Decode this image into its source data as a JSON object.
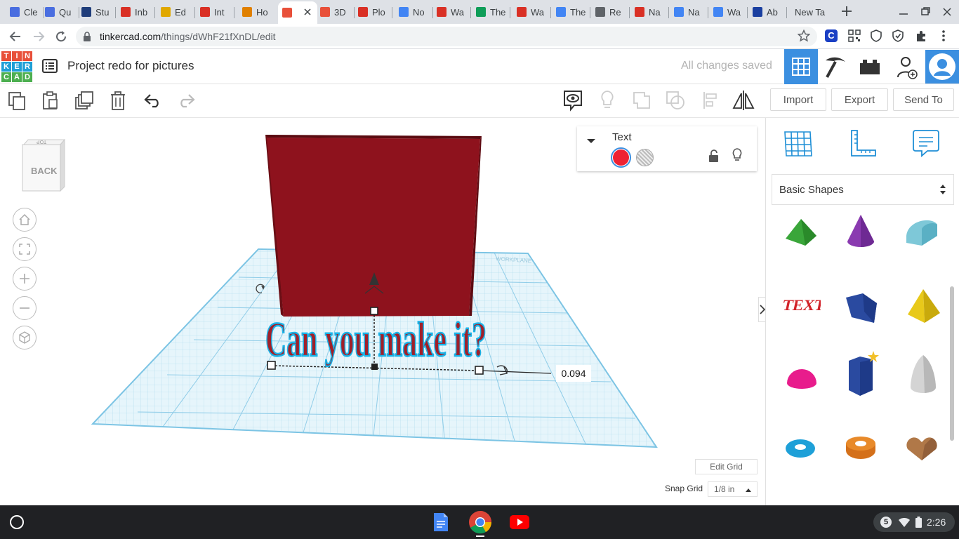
{
  "browser": {
    "tabs": [
      {
        "label": "Cle",
        "color": "#4a6ee0"
      },
      {
        "label": "Qu",
        "color": "#4a6ee0"
      },
      {
        "label": "Stu",
        "color": "#1f3d7a"
      },
      {
        "label": "Inb",
        "color": "#d93025"
      },
      {
        "label": "Ed",
        "color": "#e0a800"
      },
      {
        "label": "Int",
        "color": "#d93025"
      },
      {
        "label": "Ho",
        "color": "#e08000"
      },
      {
        "label": "",
        "color": "#e8503a"
      },
      {
        "label": "3D",
        "color": "#e8503a"
      },
      {
        "label": "Plo",
        "color": "#d93025"
      },
      {
        "label": "No",
        "color": "#4285f4"
      },
      {
        "label": "Wa",
        "color": "#d93025"
      },
      {
        "label": "The",
        "color": "#0f9d58"
      },
      {
        "label": "Wa",
        "color": "#d93025"
      },
      {
        "label": "The",
        "color": "#4285f4"
      },
      {
        "label": "Re",
        "color": "#5f6368"
      },
      {
        "label": "Na",
        "color": "#d93025"
      },
      {
        "label": "Na",
        "color": "#4285f4"
      },
      {
        "label": "Wa",
        "color": "#4285f4"
      },
      {
        "label": "Ab",
        "color": "#1a3fa0"
      },
      {
        "label": "New Ta",
        "color": "#dee1e6"
      }
    ],
    "url_host": "tinkercad.com",
    "url_path": "/things/dWhF21fXnDL/edit"
  },
  "header": {
    "logo_letters": [
      "TIN",
      "KER",
      "CAD"
    ],
    "project_title": "Project redo for pictures",
    "save_status": "All changes saved"
  },
  "toolbar": {
    "import_label": "Import",
    "export_label": "Export",
    "send_to_label": "Send To"
  },
  "viewcube": {
    "top_label": "TOP",
    "front_label": "BACK"
  },
  "shape_inspector": {
    "title": "Text",
    "solid_color": "#ee2233",
    "mode": "solid"
  },
  "workplane": {
    "text_object": "Can you make it?",
    "dimension_value": "0.094",
    "edit_grid_label": "Edit Grid",
    "snap_grid_label": "Snap Grid",
    "snap_grid_value": "1/8 in"
  },
  "shapes_panel": {
    "category": "Basic Shapes",
    "text_shape_label": "TEXT"
  },
  "taskbar": {
    "notification_count": "5",
    "time": "2:26"
  }
}
